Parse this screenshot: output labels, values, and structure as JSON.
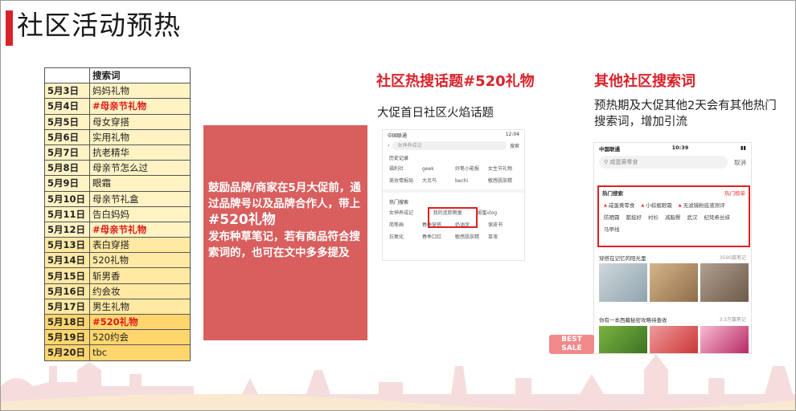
{
  "slide": {
    "title": "社区活动预热"
  },
  "keyword_table": {
    "header": "搜索词",
    "rows": [
      {
        "date": "5月3日",
        "term": "妈妈礼物"
      },
      {
        "date": "5月4日",
        "term": "#母亲节礼物",
        "highlight": true
      },
      {
        "date": "5月5日",
        "term": "母女穿搭"
      },
      {
        "date": "5月6日",
        "term": "实用礼物"
      },
      {
        "date": "5月7日",
        "term": "抗老精华"
      },
      {
        "date": "5月8日",
        "term": "母亲节怎么过"
      },
      {
        "date": "5月9日",
        "term": "眼霜"
      },
      {
        "date": "5月10日",
        "term": "母亲节礼盒"
      },
      {
        "date": "5月11日",
        "term": "告白妈妈"
      },
      {
        "date": "5月12日",
        "term": "#母亲节礼物",
        "highlight": true
      },
      {
        "date": "5月13日",
        "term": "表白穿搭"
      },
      {
        "date": "5月14日",
        "term": "520礼物"
      },
      {
        "date": "5月15日",
        "term": "斩男香"
      },
      {
        "date": "5月16日",
        "term": "约会妆"
      },
      {
        "date": "5月17日",
        "term": "男生礼物"
      },
      {
        "date": "5月18日",
        "term": "#520礼物",
        "highlight": true
      },
      {
        "date": "5月19日",
        "term": "520约会"
      },
      {
        "date": "5月20日",
        "term": "tbc"
      }
    ]
  },
  "promo": {
    "line1": "鼓励品牌/商家在5月大促前，通过品牌号以及品牌合作人，带上",
    "tag": "#520礼物",
    "line2": "发布种草笔记，若有商品符合搜索词的，也可在文中多多提及"
  },
  "hot_topic": {
    "title": "社区热搜话题#520礼物",
    "desc": "大促首日社区火焰话题",
    "phone": {
      "status_left": "中国联通",
      "status_right": "12:04",
      "search_placeholder": "女神养成记",
      "search_btn": "搜索",
      "history_label": "历史记录",
      "history_row1": [
        "福利社",
        "geek",
        "好笔小能报",
        "女生节礼物"
      ],
      "history_row2": [
        "美妆情报局",
        "大另鸟",
        "bechi",
        "敏感肌肤精"
      ],
      "hot_label": "热门搜索",
      "hot_row1": [
        "女神养成记",
        "我的追踪雨量",
        "闺蜜vlog"
      ],
      "hot_row2": [
        "简笔画",
        "春季穿搭",
        "奶油泥",
        "保皮书"
      ],
      "hot_row3": [
        "抗氧化",
        "春季口红",
        "敏感肌肤精",
        "苗液"
      ]
    }
  },
  "other_search": {
    "title": "其他社区搜索词",
    "desc": "预热期及大促其他2天会有其他热门搜索词，增加引流",
    "phone": {
      "status_left": "中国联通",
      "status_time": "10:39",
      "search_placeholder": "咸蛋黄零食",
      "cancel": "取消",
      "hot_label": "热门搜索",
      "hot_rank": "热门榜单",
      "tags": [
        {
          "text": "咸蛋黄零食",
          "fire": true
        },
        {
          "text": "小棕瓶眼霜",
          "fire": true
        },
        {
          "text": "无滤镜粉底液测评",
          "fire": true
        },
        {
          "text": "防晒霜",
          "fire": false
        },
        {
          "text": "都挺好",
          "fire": false
        },
        {
          "text": "衬衫",
          "fire": false
        },
        {
          "text": "减脂餐",
          "fire": false
        },
        {
          "text": "武汉",
          "fire": false
        },
        {
          "text": "纪梵希丝袜",
          "fire": false
        },
        {
          "text": "马甲线",
          "fire": false
        }
      ],
      "sub1": "穿搭在记忆的阳光里",
      "sub1_count": "3590篇笔记",
      "sub2": "你有一本西藏秘密攻略待查收",
      "sub2_count": "3.3万篇笔记"
    }
  },
  "badge": {
    "line1": "BEST",
    "line2": "SALE"
  },
  "colors": {
    "accent_red": "#d8232a",
    "promo_bg": "#d95e5e",
    "highlight_text": "#e01818"
  }
}
